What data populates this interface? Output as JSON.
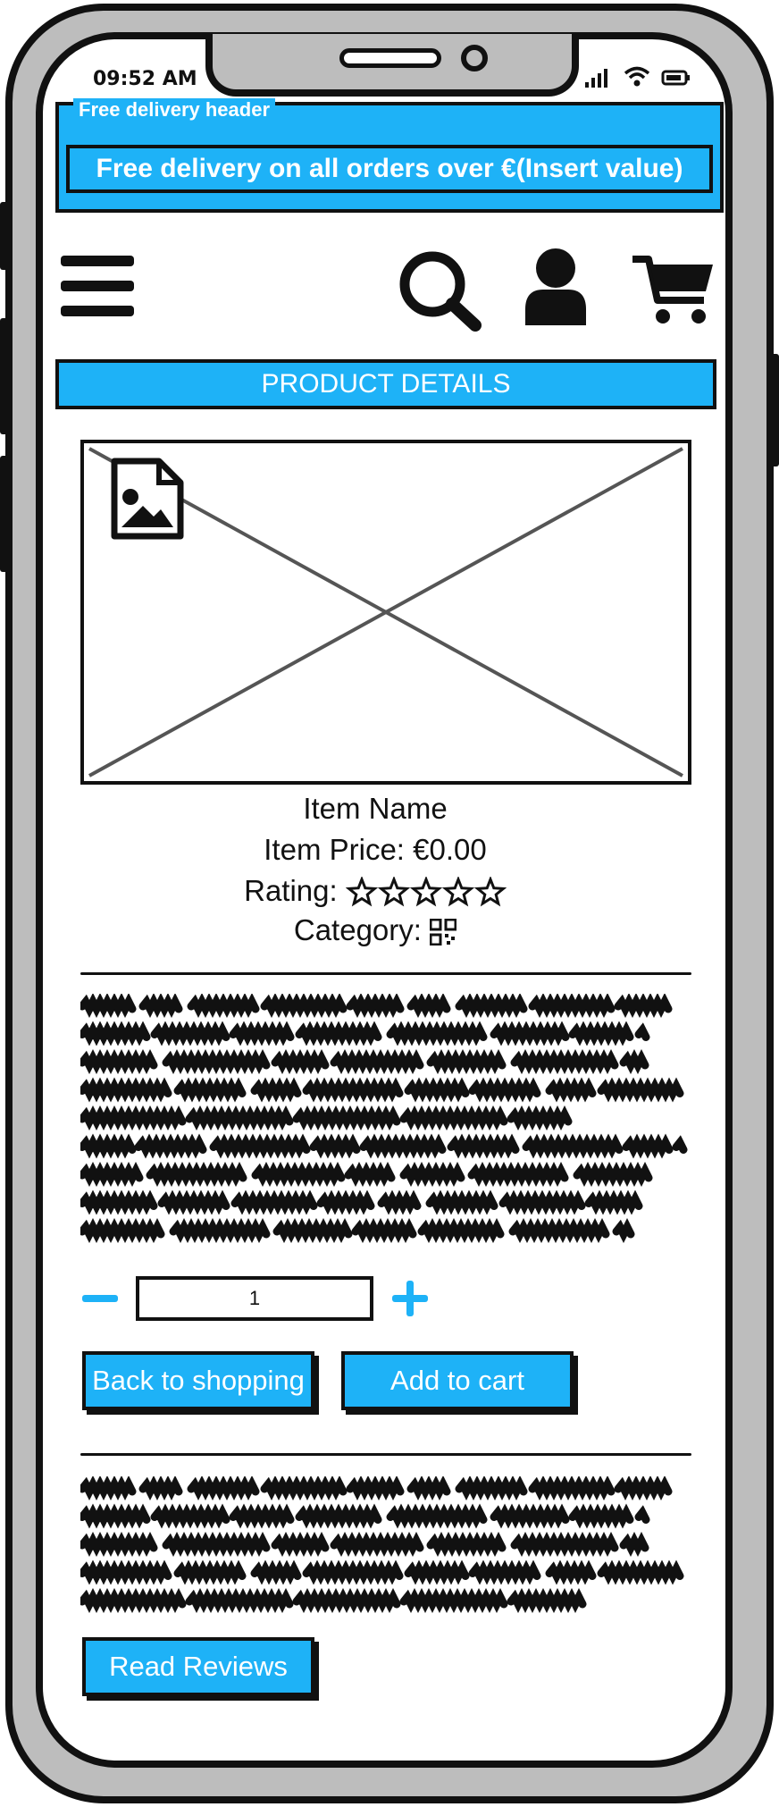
{
  "status_bar": {
    "time": "09:52 AM"
  },
  "delivery": {
    "legend": "Free delivery header",
    "banner": "Free delivery on all orders over €(Insert value)"
  },
  "nav": {
    "icons": [
      "menu-icon",
      "search-icon",
      "user-icon",
      "cart-icon"
    ]
  },
  "section_title": "PRODUCT DETAILS",
  "product": {
    "name": "Item Name",
    "price": "Item Price: €0.00",
    "rating_label": "Rating:",
    "rating_stars": 5,
    "category_label": "Category:"
  },
  "quantity": {
    "value": "1"
  },
  "buttons": {
    "back": "Back to shopping",
    "add": "Add to cart",
    "reviews": "Read Reviews"
  },
  "colors": {
    "accent": "#1eb2f7",
    "ink": "#111111",
    "frame": "#bdbdbd"
  }
}
